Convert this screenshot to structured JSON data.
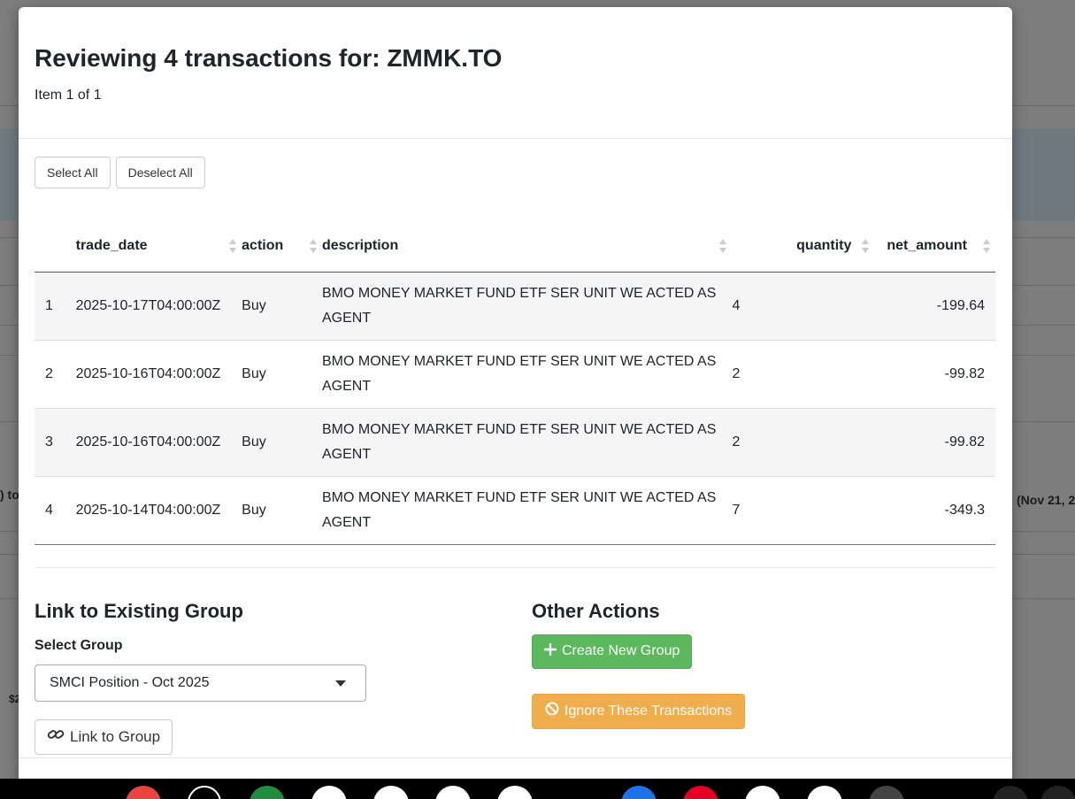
{
  "modal": {
    "title": "Reviewing 4 transactions for: ZMMK.TO",
    "subtitle": "Item 1 of 1",
    "select_all": "Select All",
    "deselect_all": "Deselect All"
  },
  "table": {
    "columns": [
      "trade_date",
      "action",
      "description",
      "quantity",
      "net_amount"
    ],
    "rows": [
      {
        "index": "1",
        "trade_date": "2025-10-17T04:00:00Z",
        "action": "Buy",
        "description": "BMO MONEY MARKET FUND ETF SER UNIT WE ACTED AS AGENT",
        "quantity": "4",
        "net_amount": "-199.64"
      },
      {
        "index": "2",
        "trade_date": "2025-10-16T04:00:00Z",
        "action": "Buy",
        "description": "BMO MONEY MARKET FUND ETF SER UNIT WE ACTED AS AGENT",
        "quantity": "2",
        "net_amount": "-99.82"
      },
      {
        "index": "3",
        "trade_date": "2025-10-16T04:00:00Z",
        "action": "Buy",
        "description": "BMO MONEY MARKET FUND ETF SER UNIT WE ACTED AS AGENT",
        "quantity": "2",
        "net_amount": "-99.82"
      },
      {
        "index": "4",
        "trade_date": "2025-10-14T04:00:00Z",
        "action": "Buy",
        "description": "BMO MONEY MARKET FUND ETF SER UNIT WE ACTED AS AGENT",
        "quantity": "7",
        "net_amount": "-349.3"
      }
    ]
  },
  "link_section": {
    "title": "Link to Existing Group",
    "select_label": "Select Group",
    "selected_group": "SMCI Position - Oct 2025",
    "link_button": "Link to Group"
  },
  "other_actions": {
    "title": "Other Actions",
    "create_button": "Create New Group",
    "ignore_button": "Ignore These Transactions"
  },
  "background": {
    "left_fragment": ") to",
    "right_fragment": "(Nov 21, 2",
    "left_fragment_2": "$2"
  },
  "colors": {
    "success": "#5cb85c",
    "warning": "#f0ad4e"
  }
}
